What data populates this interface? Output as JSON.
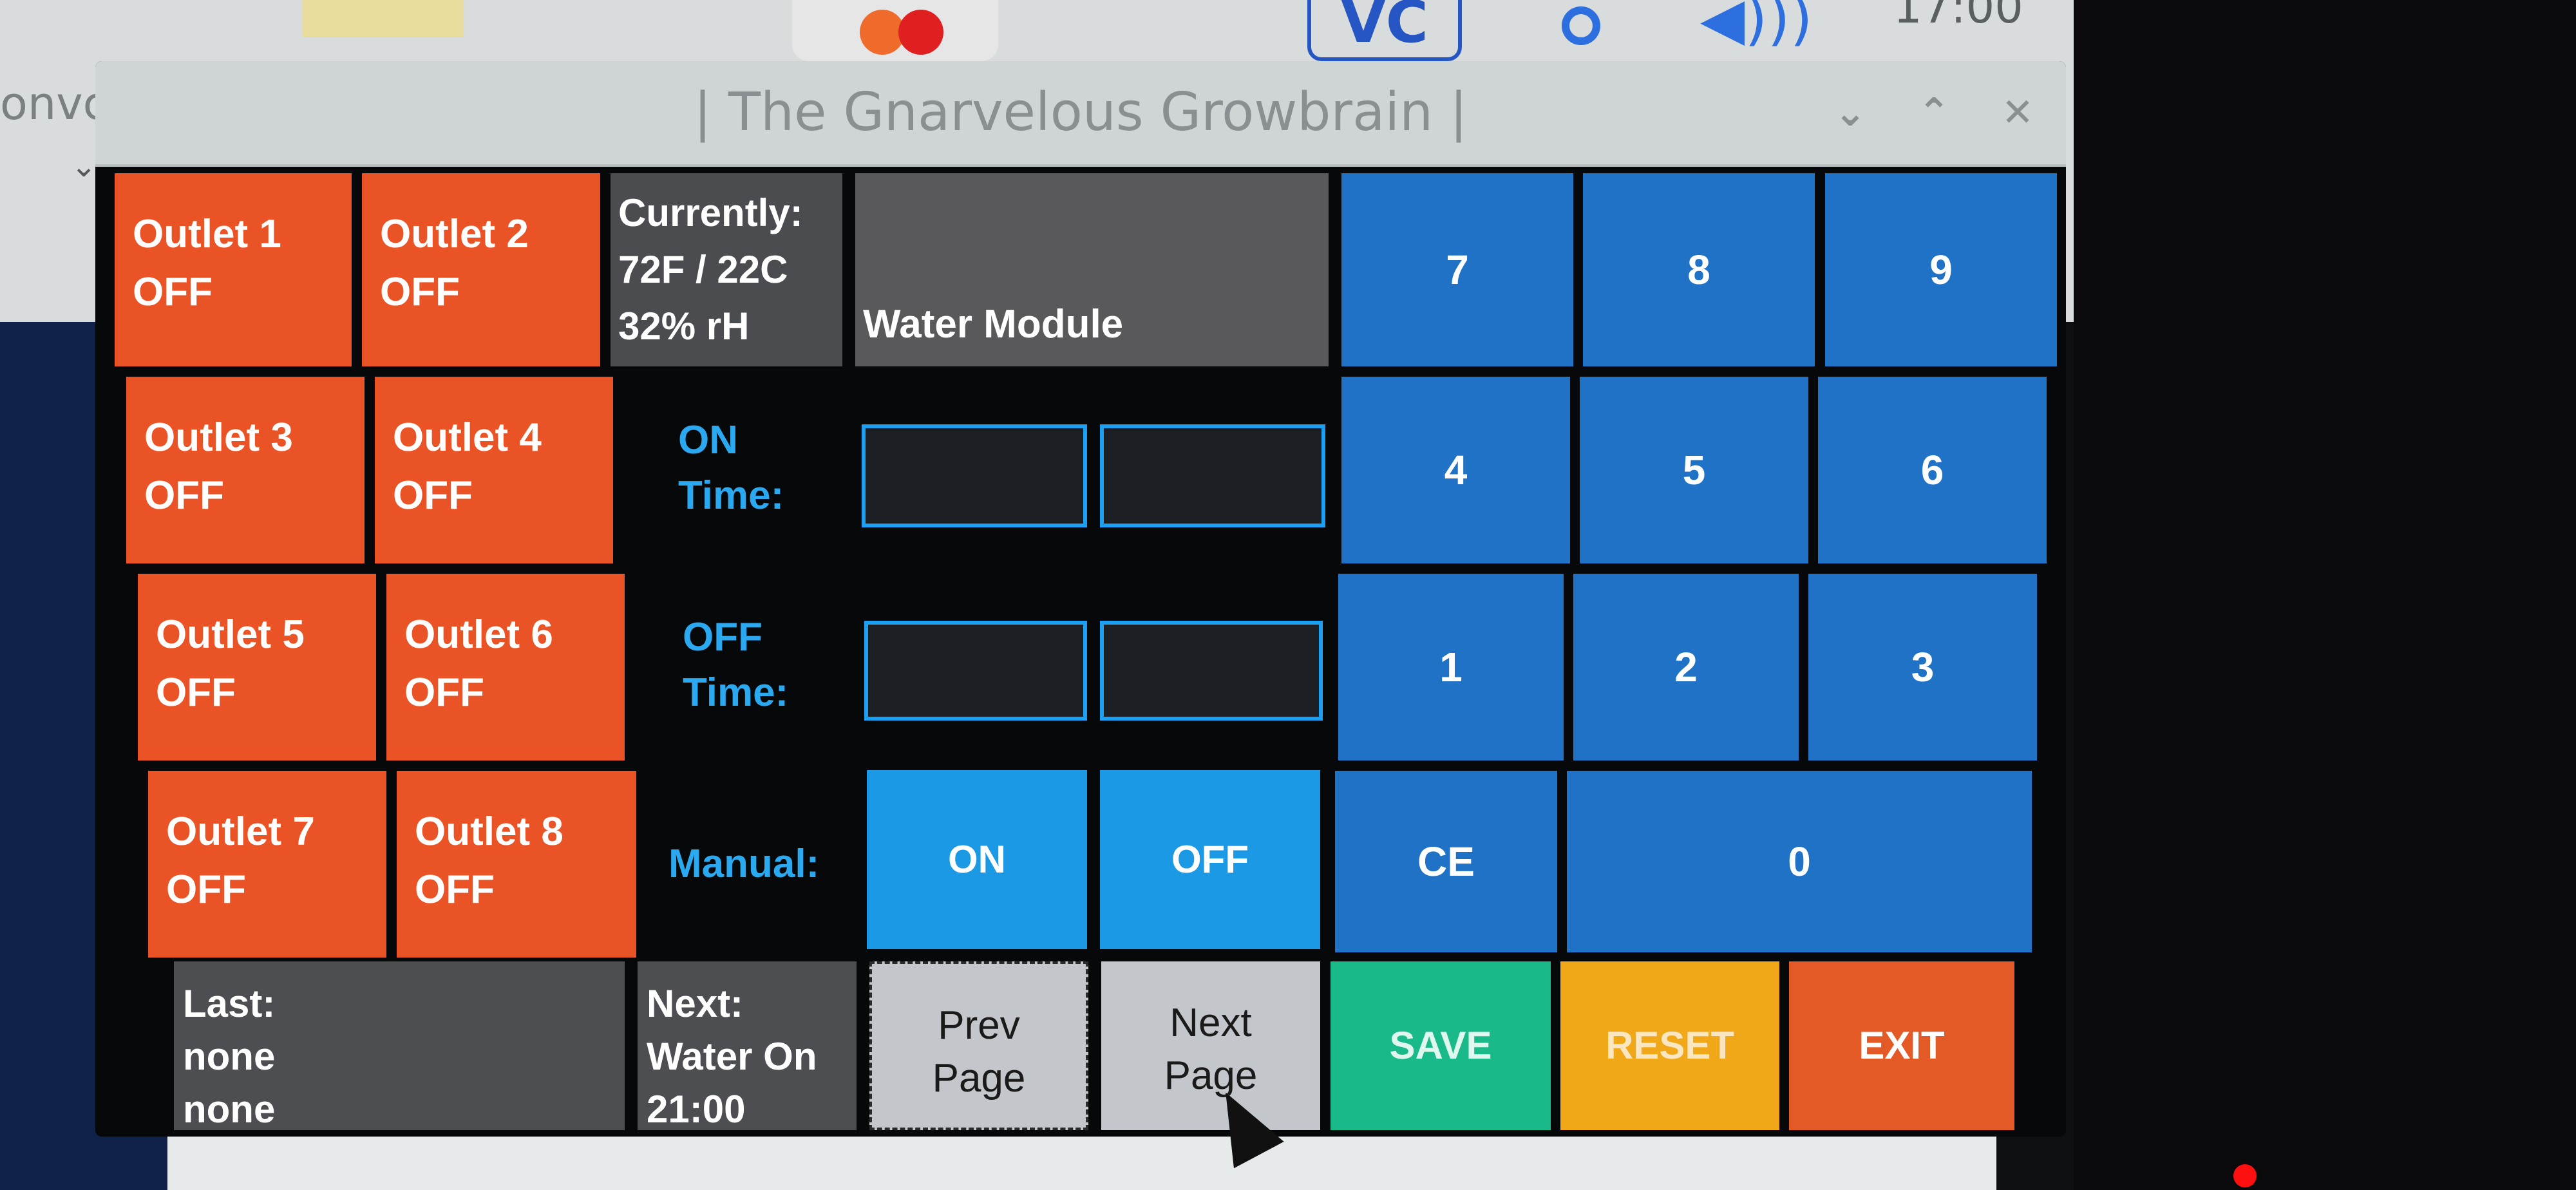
{
  "desktop": {
    "partial_text": "onvc",
    "clock_partial": "17:00",
    "tray_vc_label": "VC",
    "colors": {
      "background_light": "#d8dcdc",
      "background_blue": "#10214a"
    }
  },
  "window": {
    "title": "|   The Gnarvelous Growbrain   |",
    "controls": {
      "minimize_icon": "chevron-down-icon",
      "maximize_icon": "chevron-up-icon",
      "close_icon": "close-icon"
    }
  },
  "outlets": [
    {
      "name": "Outlet 1",
      "state": "OFF"
    },
    {
      "name": "Outlet 2",
      "state": "OFF"
    },
    {
      "name": "Outlet 3",
      "state": "OFF"
    },
    {
      "name": "Outlet 4",
      "state": "OFF"
    },
    {
      "name": "Outlet 5",
      "state": "OFF"
    },
    {
      "name": "Outlet 6",
      "state": "OFF"
    },
    {
      "name": "Outlet 7",
      "state": "OFF"
    },
    {
      "name": "Outlet 8",
      "state": "OFF"
    }
  ],
  "status": {
    "currently_label": "Currently:",
    "temperature": "72F / 22C",
    "humidity": "32% rH",
    "module_name": "Water Module"
  },
  "schedule": {
    "on_time_label_1": "ON",
    "on_time_label_2": "Time:",
    "off_time_label_1": "OFF",
    "off_time_label_2": "Time:",
    "on_time_values": [
      "",
      ""
    ],
    "off_time_values": [
      "",
      ""
    ],
    "manual_label": "Manual:",
    "manual_on": "ON",
    "manual_off": "OFF"
  },
  "keypad": {
    "keys": [
      "7",
      "8",
      "9",
      "4",
      "5",
      "6",
      "1",
      "2",
      "3"
    ],
    "clear": "CE",
    "zero": "0"
  },
  "footer": {
    "last_label": "Last:",
    "last_line1": "none",
    "last_line2": "none",
    "next_label": "Next:",
    "next_line1": "Water On",
    "next_line2": "21:00",
    "prev_page_1": "Prev",
    "prev_page_2": "Page",
    "next_page_1": "Next",
    "next_page_2": "Page",
    "save": "SAVE",
    "reset": "RESET",
    "exit": "EXIT"
  },
  "colors": {
    "outlet_off": "#ea5325",
    "keypad": "#1f72c6",
    "manual": "#1c99e4",
    "save": "#19b98a",
    "reset": "#f0a818",
    "exit": "#e45a26",
    "label_blue": "#2aa8f0"
  }
}
